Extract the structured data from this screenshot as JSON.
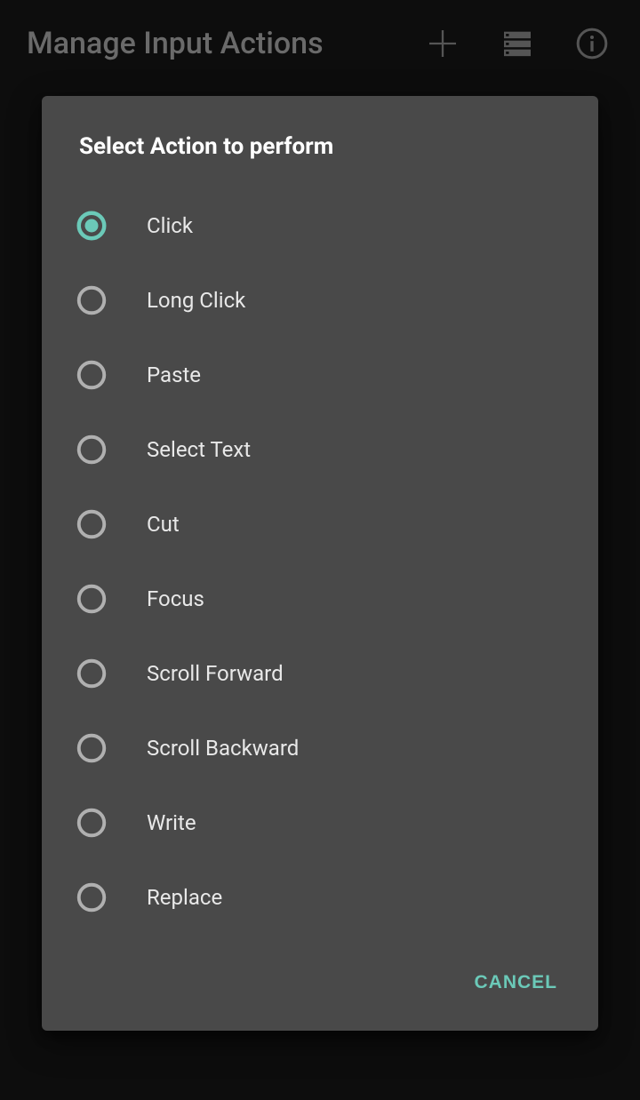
{
  "header": {
    "title": "Manage Input Actions"
  },
  "dialog": {
    "title": "Select Action to perform",
    "cancel_label": "CANCEL",
    "options": [
      {
        "label": "Click",
        "selected": true
      },
      {
        "label": "Long Click",
        "selected": false
      },
      {
        "label": "Paste",
        "selected": false
      },
      {
        "label": "Select Text",
        "selected": false
      },
      {
        "label": "Cut",
        "selected": false
      },
      {
        "label": "Focus",
        "selected": false
      },
      {
        "label": "Scroll Forward",
        "selected": false
      },
      {
        "label": "Scroll Backward",
        "selected": false
      },
      {
        "label": "Write",
        "selected": false
      },
      {
        "label": "Replace",
        "selected": false
      }
    ]
  }
}
